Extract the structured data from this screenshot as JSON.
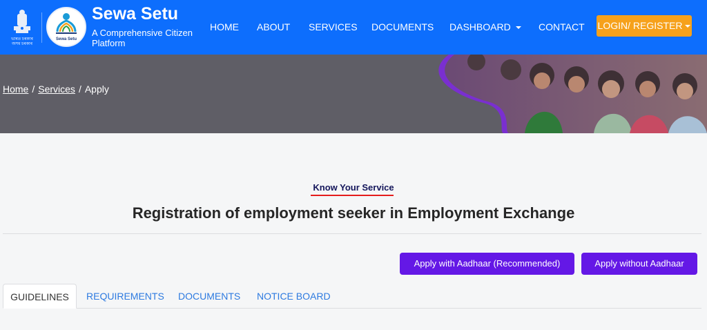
{
  "header": {
    "emblem_text": "ভাৰত চৰকাৰ\nঅসম চৰকাৰ",
    "logo_text": "Sewa Setu",
    "brand_title": "Sewa Setu",
    "brand_subtitle": "A Comprehensive Citizen Platform",
    "nav": [
      {
        "label": "HOME"
      },
      {
        "label": "ABOUT"
      },
      {
        "label": "SERVICES"
      },
      {
        "label": "DOCUMENTS"
      },
      {
        "label": "DASHBOARD",
        "dropdown": true
      },
      {
        "label": "CONTACT"
      }
    ],
    "login_label": "LOGIN/ REGISTER",
    "colors": {
      "nav_bg": "#0d6efd",
      "login_bg": "#f6a11b"
    }
  },
  "breadcrumb": {
    "items": [
      "Home",
      "Services",
      "Apply"
    ],
    "separator": "/"
  },
  "main": {
    "eyebrow": "Know Your Service",
    "title": "Registration of employment seeker in Employment Exchange",
    "buttons": {
      "apply_aadhaar": "Apply with Aadhaar (Recommended)",
      "apply_no_aadhaar": "Apply without Aadhaar"
    },
    "tabs": [
      {
        "label": "GUIDELINES",
        "active": true
      },
      {
        "label": "REQUIREMENTS"
      },
      {
        "label": "DOCUMENTS"
      },
      {
        "label": "NOTICE BOARD"
      }
    ],
    "colors": {
      "primary": "#6418e6",
      "accent_line": "#e51b1b"
    }
  }
}
